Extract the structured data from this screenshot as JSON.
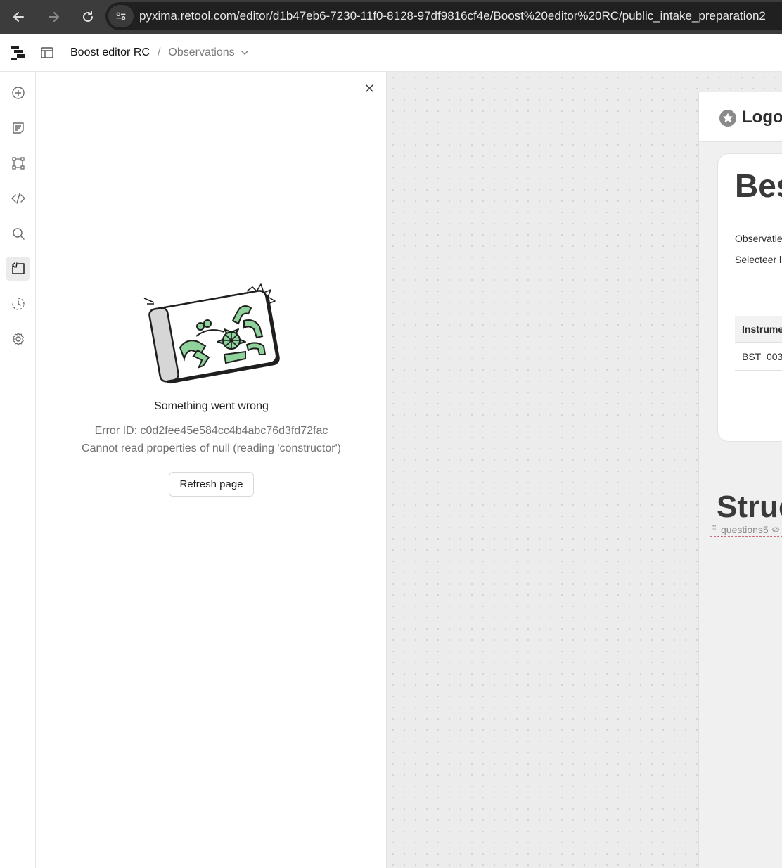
{
  "browser": {
    "url": "pyxima.retool.com/editor/d1b47eb6-7230-11f0-8128-97df9816cf4e/Boost%20editor%20RC/public_intake_preparation2",
    "back_icon": "arrow-left-icon",
    "forward_icon": "arrow-right-icon",
    "reload_icon": "reload-icon",
    "site_info_icon": "tune-icon"
  },
  "header": {
    "app_name": "Boost editor RC",
    "separator": "/",
    "page_name": "Observations"
  },
  "rail": {
    "items": [
      {
        "icon": "add-circle-icon"
      },
      {
        "icon": "page-icon"
      },
      {
        "icon": "components-icon"
      },
      {
        "icon": "code-icon"
      },
      {
        "icon": "search-icon"
      },
      {
        "icon": "debug-icon",
        "active": true
      },
      {
        "icon": "history-icon"
      },
      {
        "icon": "settings-icon"
      }
    ]
  },
  "error_panel": {
    "title": "Something went wrong",
    "error_id": "Error ID: c0d2fee45e584cc4b4abc76d3fd72fac",
    "message": "Cannot read properties of null (reading 'constructor')",
    "refresh_label": "Refresh page"
  },
  "canvas": {
    "logo_text": "Logo",
    "card": {
      "heading": "Bes",
      "label1": "Observatie",
      "label2": "Selecteer l",
      "table_header": "Instrume",
      "table_cell": "BST_003"
    },
    "section_heading": "Struc",
    "component_tag": "questions5"
  },
  "colors": {
    "chrome_bg": "#3c3c3c",
    "canvas_bg": "#ececec",
    "illustration_green": "#8fd29c"
  }
}
